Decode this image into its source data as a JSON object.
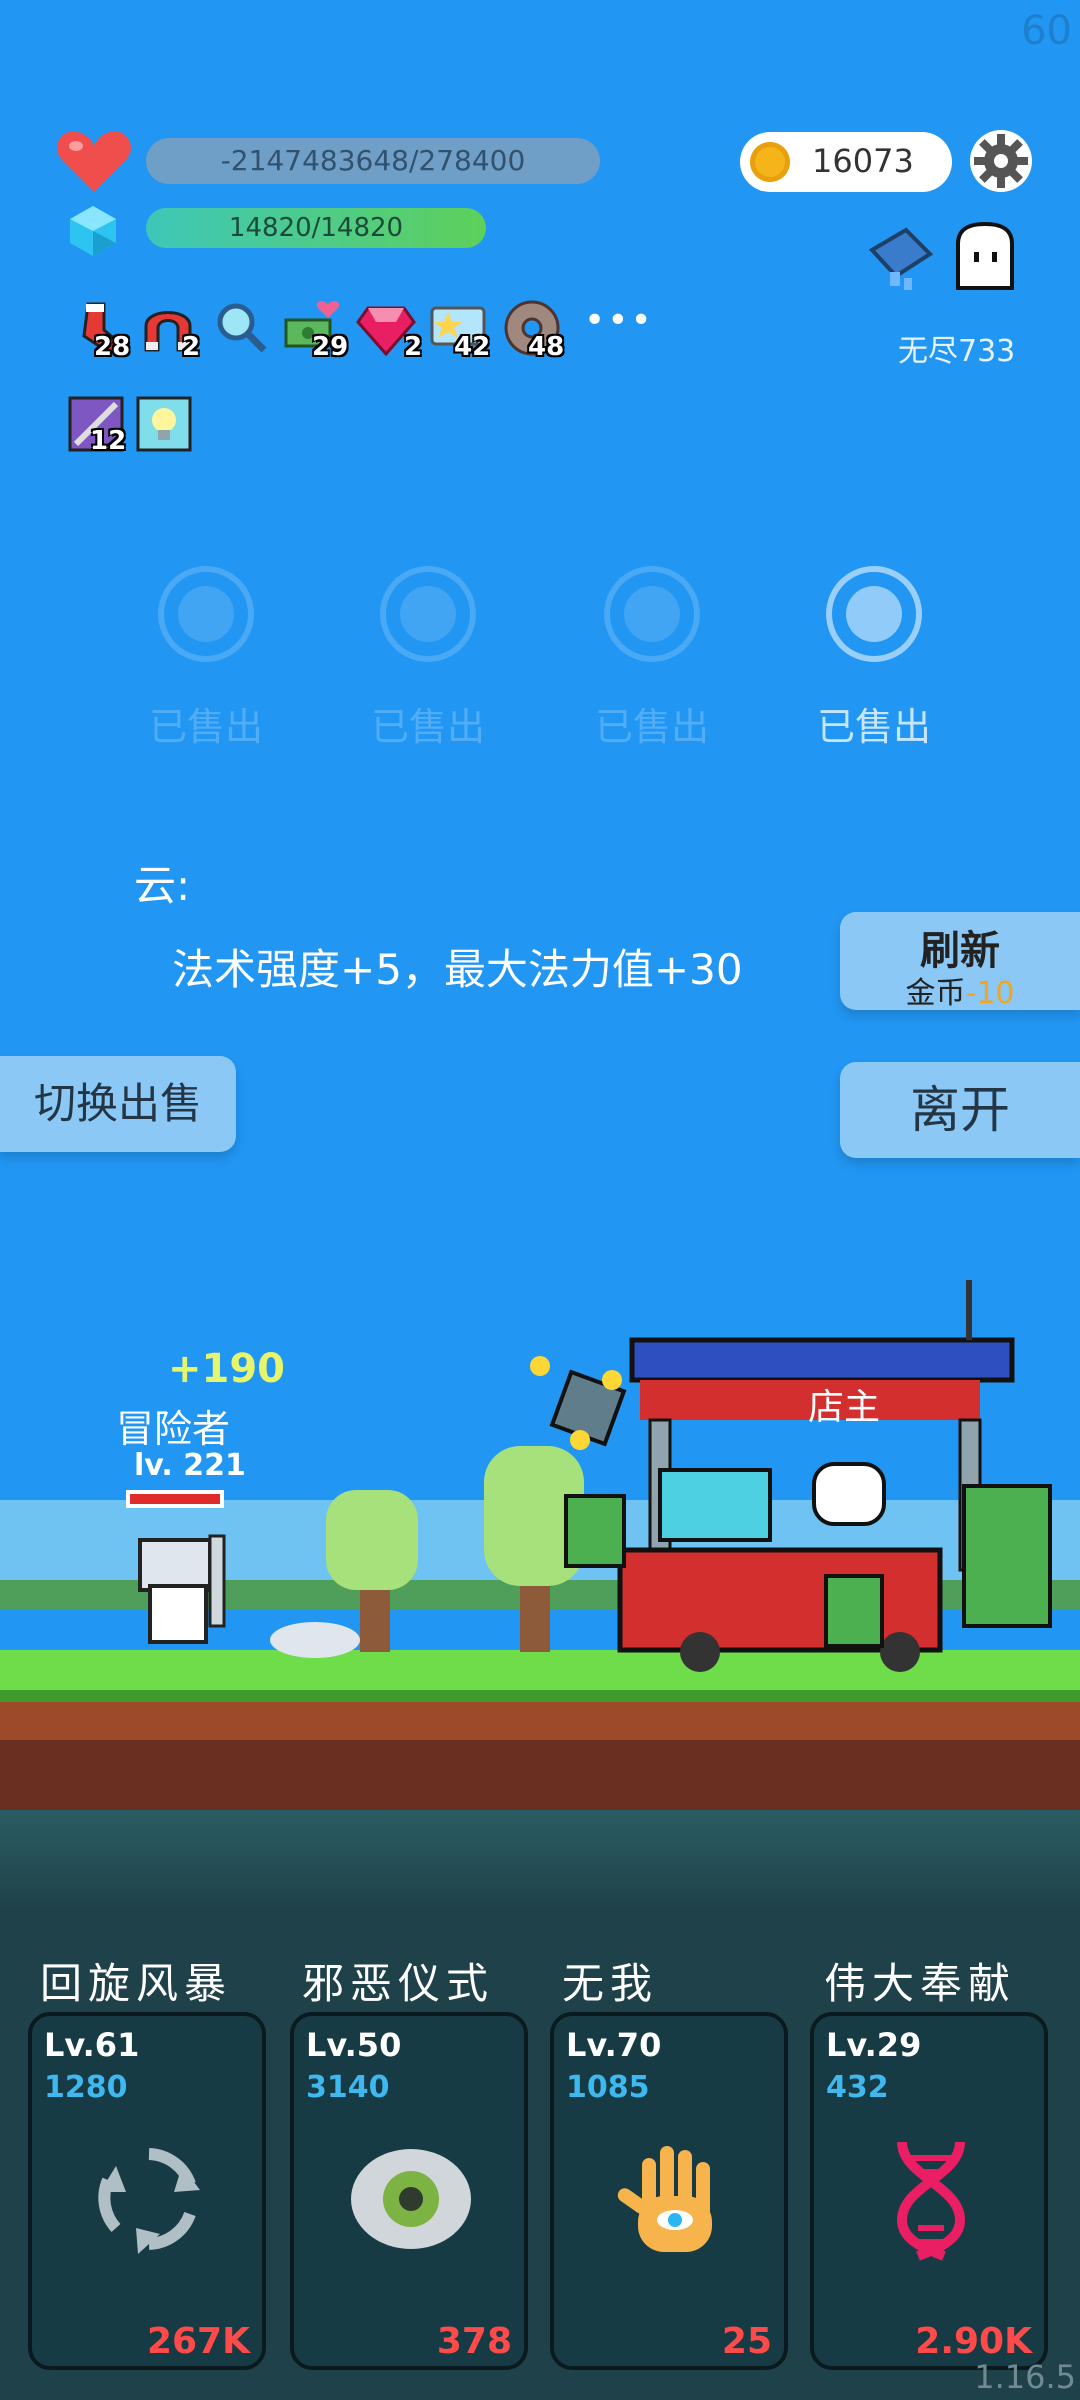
{
  "fps": "60",
  "version": "1.16.5",
  "stats": {
    "hp": "-2147483648/278400",
    "mp": "14820/14820"
  },
  "coins": "16073",
  "mode": "无尽733",
  "items": [
    {
      "icon": "sock-icon",
      "count": "28"
    },
    {
      "icon": "magnet-icon",
      "count": "2"
    },
    {
      "icon": "magnifier-icon",
      "count": ""
    },
    {
      "icon": "money-heart-icon",
      "count": "29"
    },
    {
      "icon": "ruby-icon",
      "count": "2"
    },
    {
      "icon": "star-card-icon",
      "count": "42"
    },
    {
      "icon": "donut-icon",
      "count": "48"
    },
    {
      "icon": "sword-box-icon",
      "count": "12"
    },
    {
      "icon": "lightbulb-icon",
      "count": ""
    }
  ],
  "more": "•••",
  "shop": {
    "slots": [
      {
        "label": "已售出",
        "active": false
      },
      {
        "label": "已售出",
        "active": false
      },
      {
        "label": "已售出",
        "active": false
      },
      {
        "label": "已售出",
        "active": true
      }
    ],
    "desc_name": "云:",
    "desc_text": "法术强度+5，最大法力值+30",
    "refresh_label": "刷新",
    "refresh_currency": "金币",
    "refresh_cost": "-10",
    "leave_label": "离开",
    "switch_label": "切换出售"
  },
  "scene": {
    "gain": "+190",
    "player_name": "冒险者",
    "player_level": "lv. 221",
    "shop_label": "店主"
  },
  "skills": [
    {
      "name": "回旋风暴",
      "level": "Lv.61",
      "power": "1280",
      "cost": "267K",
      "icon": "cycle-arrows-icon"
    },
    {
      "name": "邪恶仪式",
      "level": "Lv.50",
      "power": "3140",
      "cost": "378",
      "icon": "eye-icon"
    },
    {
      "name": "无我",
      "level": "Lv.70",
      "power": "1085",
      "cost": "25",
      "icon": "hamsa-hand-icon"
    },
    {
      "name": "伟大奉献",
      "level": "Lv.29",
      "power": "432",
      "cost": "2.90K",
      "icon": "dna-icon"
    }
  ]
}
